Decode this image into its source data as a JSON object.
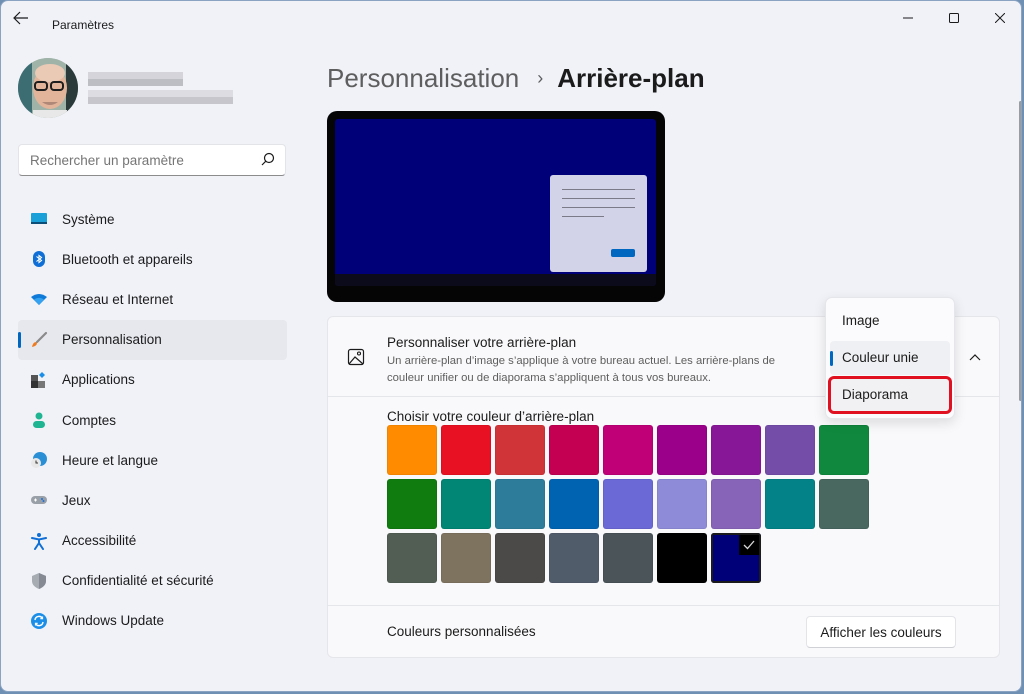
{
  "window": {
    "title": "Paramètres",
    "controls": {
      "minimize": "minimize",
      "maximize": "maximize",
      "close": "close"
    }
  },
  "profile": {
    "name": "(blurred)",
    "email": "(blurred)"
  },
  "search": {
    "placeholder": "Rechercher un paramètre",
    "value": ""
  },
  "sidebar": {
    "items": [
      {
        "label": "Système",
        "icon": "system-icon",
        "active": false
      },
      {
        "label": "Bluetooth et appareils",
        "icon": "bluetooth-icon",
        "active": false
      },
      {
        "label": "Réseau et Internet",
        "icon": "wifi-icon",
        "active": false
      },
      {
        "label": "Personnalisation",
        "icon": "paintbrush-icon",
        "active": true
      },
      {
        "label": "Applications",
        "icon": "apps-icon",
        "active": false
      },
      {
        "label": "Comptes",
        "icon": "account-icon",
        "active": false
      },
      {
        "label": "Heure et langue",
        "icon": "time-language-icon",
        "active": false
      },
      {
        "label": "Jeux",
        "icon": "gamepad-icon",
        "active": false
      },
      {
        "label": "Accessibilité",
        "icon": "accessibility-icon",
        "active": false
      },
      {
        "label": "Confidentialité et sécurité",
        "icon": "shield-icon",
        "active": false
      },
      {
        "label": "Windows Update",
        "icon": "update-icon",
        "active": false
      }
    ]
  },
  "breadcrumb": {
    "parent": "Personnalisation",
    "separator": "›",
    "current": "Arrière-plan"
  },
  "preview": {
    "background_color": "#000078"
  },
  "background_card": {
    "title": "Personnaliser votre arrière-plan",
    "description": "Un arrière-plan d’image s’applique à votre bureau actuel. Les arrière-plans de couleur unifier ou de diaporama s’appliquent à tous vos bureaux.",
    "dropdown": {
      "options": [
        "Image",
        "Couleur unie",
        "Diaporama"
      ],
      "selected": "Couleur unie",
      "highlighted": "Diaporama"
    },
    "color_picker_label": "Choisir votre couleur d’arrière-plan",
    "colors": [
      "#ff8c00",
      "#e81123",
      "#d13438",
      "#c30052",
      "#bf0077",
      "#9a0089",
      "#881798",
      "#744da9",
      "#10893e",
      "#107c10",
      "#018574",
      "#2d7d9a",
      "#0063b1",
      "#6b69d6",
      "#8e8cd8",
      "#8764b8",
      "#038387",
      "#486860",
      "#525e54",
      "#7e735f",
      "#4c4a48",
      "#515c6b",
      "#4a5459",
      "#000000",
      "#000078"
    ],
    "selected_color": "#000078",
    "custom_colors_label": "Couleurs personnalisées",
    "show_colors_button": "Afficher les couleurs"
  }
}
